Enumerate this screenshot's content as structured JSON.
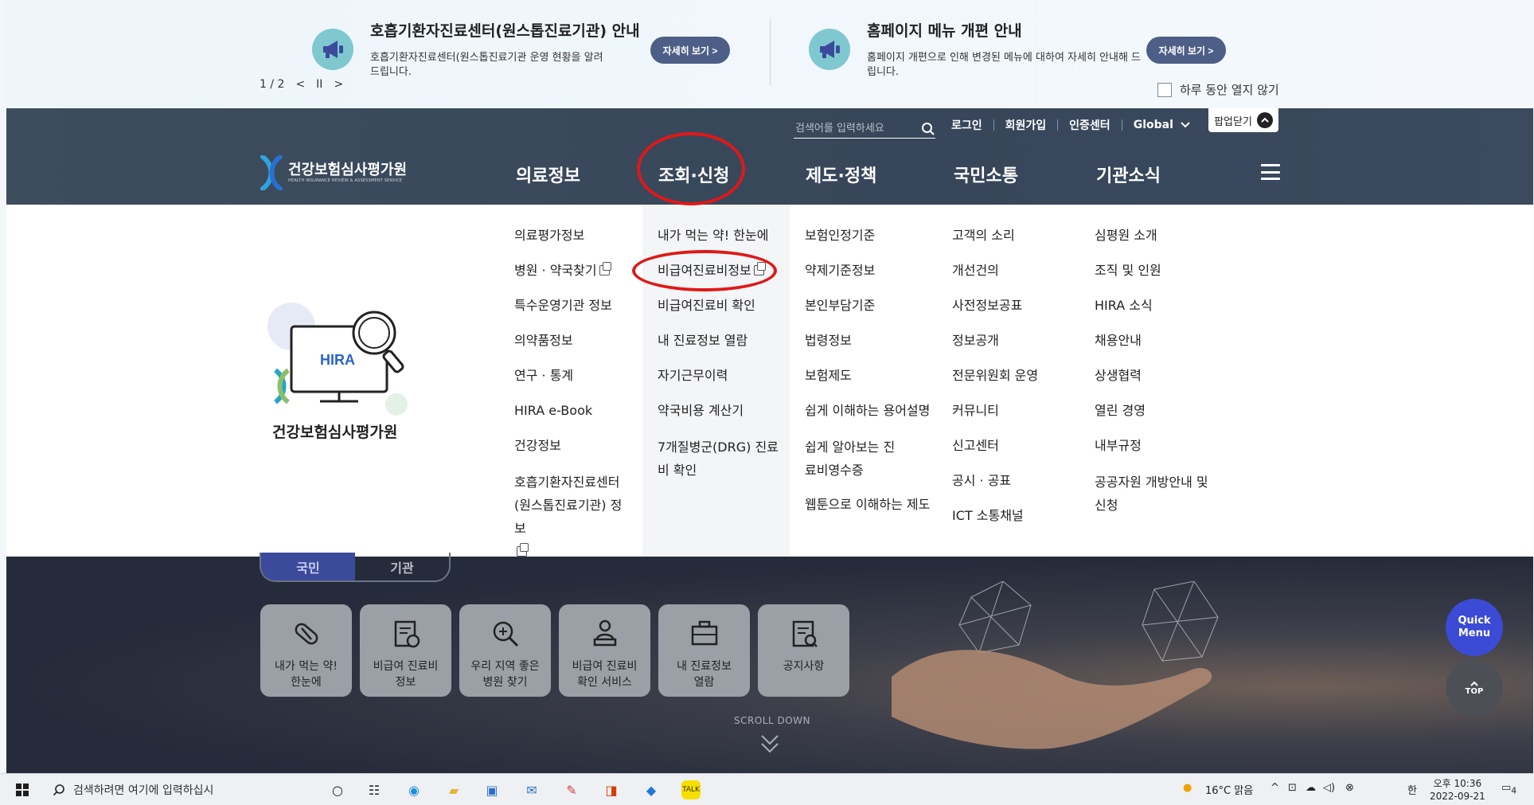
{
  "notice": {
    "items": [
      {
        "title": "호흡기환자진료센터(원스톱진료기관) 안내",
        "desc": "호흡기환자진료센터(원스톱진료기관 운영 현황을 알려드립니다.",
        "button": "자세히 보기 >"
      },
      {
        "title": "홈페이지 메뉴 개편 안내",
        "desc": "홈페이지 개편으로 인해 변경된 메뉴에 대하여 자세히 안내해 드립니다.",
        "button": "자세히 보기 >"
      }
    ],
    "pager": {
      "count": "1 / 2",
      "prev": "<",
      "pause": "II",
      "next": ">"
    },
    "dont_show": "하루 동안 열지 않기"
  },
  "header": {
    "search_placeholder": "검색어를 입력하세요",
    "util_links": [
      "로그인",
      "회원가입",
      "인증센터",
      "Global"
    ],
    "popup_close": "팝업닫기",
    "logo_name": "건강보험심사평가원",
    "logo_sub": "HEALTH INSURANCE REVIEW & ASSESSMENT SERVICE",
    "gnb": [
      "의료정보",
      "조회·신청",
      "제도·정책",
      "국민소통",
      "기관소식"
    ]
  },
  "mega": {
    "illustration_text": "HIRA",
    "illustration_label": "건강보험심사평가원",
    "columns": [
      [
        "의료평가정보",
        "병원 · 약국찾기",
        "특수운영기관 정보",
        "의약품정보",
        "연구 · 통계",
        "HIRA e-Book",
        "건강정보",
        "호흡기환자진료센터 (원스톱진료기관) 정보"
      ],
      [
        "내가 먹는 약! 한눈에",
        "비급여진료비정보",
        "비급여진료비 확인",
        "내 진료정보 열람",
        "자기근무이력",
        "약국비용 계산기",
        "7개질병군(DRG) 진료비 확인"
      ],
      [
        "보험인정기준",
        "약제기준정보",
        "본인부담기준",
        "법령정보",
        "보험제도",
        "쉽게 이해하는 용어설명",
        "쉽게 알아보는 진료비영수증",
        "웹툰으로 이해하는 제도"
      ],
      [
        "고객의 소리",
        "개선건의",
        "사전정보공표",
        "정보공개",
        "전문위원회 운영",
        "커뮤니티",
        "신고센터",
        "공시 · 공표",
        "ICT 소통채널"
      ],
      [
        "심평원 소개",
        "조직 및 인원",
        "HIRA 소식",
        "채용안내",
        "상생협력",
        "열린 경영",
        "내부규정",
        "공공자원 개방안내 및 신청"
      ]
    ]
  },
  "main": {
    "tabs": [
      "국민",
      "기관"
    ],
    "quick_links": [
      "내가 먹는 약!\n한눈에",
      "비급여 진료비\n정보",
      "우리 지역 좋은\n병원 찾기",
      "비급여 진료비\n확인 서비스",
      "내 진료정보\n열람",
      "공지사항"
    ],
    "scroll_down": "SCROLL DOWN",
    "quick_menu": "Quick Menu",
    "top": "TOP"
  },
  "taskbar": {
    "search_placeholder": "검색하려면 여기에 입력하십시",
    "weather": "16°C 맑음",
    "ime": "한",
    "time": "오후 10:36",
    "date": "2022-09-21",
    "notification_count": "4"
  }
}
